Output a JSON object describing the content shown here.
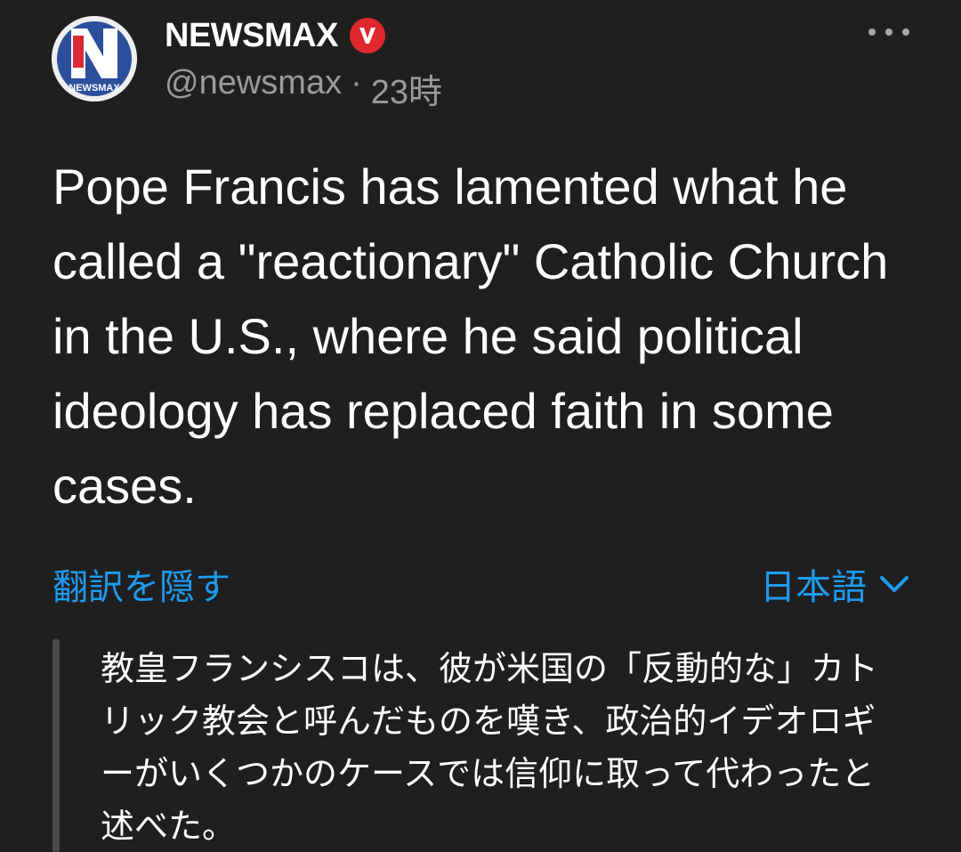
{
  "account": {
    "display_name": "NEWSMAX",
    "avatar_text": "NEWSMAX",
    "handle": "@newsmax",
    "separator": "·",
    "time": "23時"
  },
  "post": {
    "text": "Pope Francis has lamented what he called a \"reactionary\" Catholic Church in the U.S., where he said political ideology has replaced faith in some cases."
  },
  "translation": {
    "hide_label": "翻訳を隠す",
    "language_label": "日本語",
    "text": "教皇フランシスコは、彼が米国の「反動的な」カトリック教会と呼んだものを嘆き、政治的イデオロギーがいくつかのケースでは信仰に取って代わったと述べた。"
  },
  "colors": {
    "background": "#1f1f1f",
    "link": "#1d9bf0",
    "secondary_text": "#9a9a9a",
    "badge": "#e0282e",
    "logo_blue": "#2b4f9a",
    "logo_red": "#d71e27"
  },
  "icons": {
    "verified": "verified-badge-icon",
    "more": "more-options-icon",
    "language_dropdown": "chevron-down-icon"
  }
}
